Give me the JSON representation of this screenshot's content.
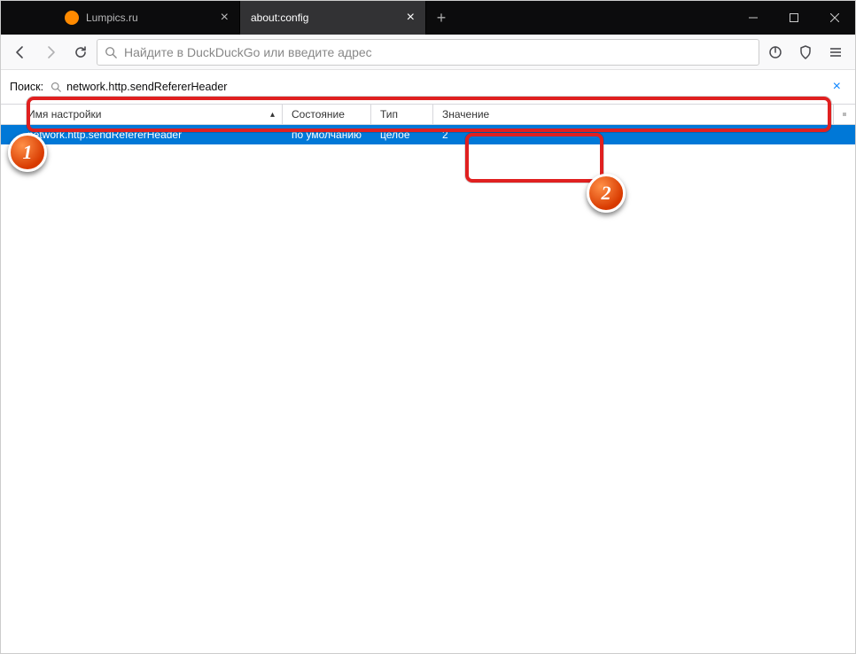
{
  "titlebar": {
    "tabs": [
      {
        "title": "Lumpics.ru",
        "favicon_color": "#ff8a00",
        "active": false
      },
      {
        "title": "about:config",
        "favicon_color": "",
        "active": true
      }
    ]
  },
  "navbar": {
    "url_placeholder": "Найдите в DuckDuckGo или введите адрес"
  },
  "config_search": {
    "label": "Поиск:",
    "value": "network.http.sendRefererHeader"
  },
  "columns": {
    "name": "Имя настройки",
    "state": "Состояние",
    "type": "Тип",
    "value": "Значение"
  },
  "row": {
    "name": "network.http.sendRefererHeader",
    "state": "по умолчанию",
    "type": "целое",
    "value": "2"
  },
  "annotations": {
    "badge1": "1",
    "badge2": "2"
  }
}
